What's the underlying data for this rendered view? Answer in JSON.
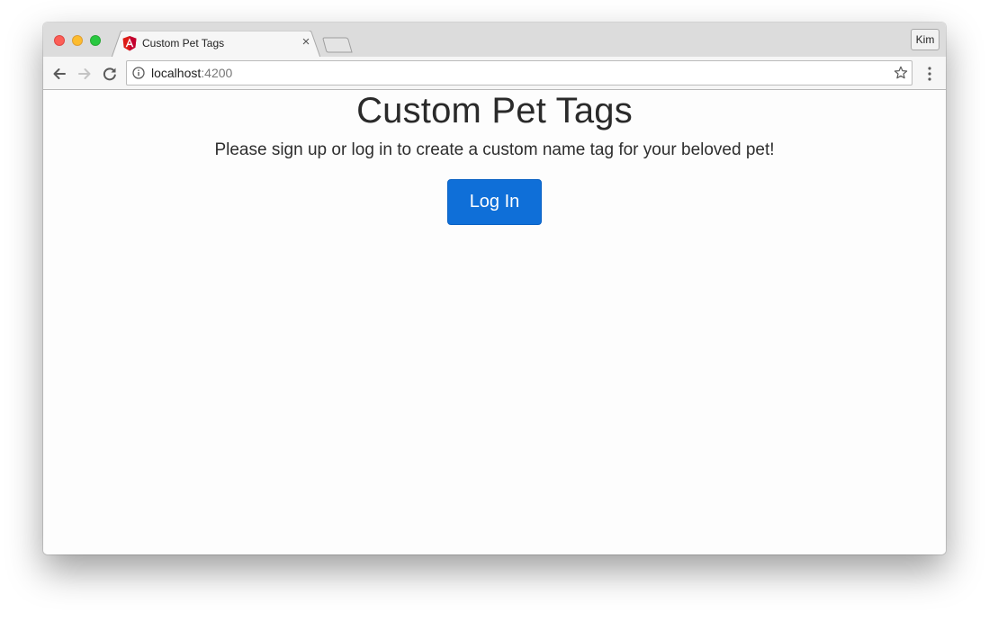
{
  "browser": {
    "tab": {
      "title": "Custom Pet Tags",
      "favicon": "angular-icon",
      "close_glyph": "×"
    },
    "profile_label": "Kim",
    "address": {
      "host": "localhost",
      "port": ":4200"
    },
    "icons": {
      "back": "back-arrow-icon",
      "forward": "forward-arrow-icon",
      "reload": "reload-icon",
      "info": "info-icon",
      "bookmark": "star-icon",
      "menu": "vertical-dots-icon"
    }
  },
  "page": {
    "title": "Custom Pet Tags",
    "subtitle": "Please sign up or log in to create a custom name tag for your beloved pet!",
    "login_label": "Log In"
  },
  "colors": {
    "accent": "#0f6fd8",
    "favicon_red": "#dd1b16",
    "traffic_red": "#fc5f57",
    "traffic_yellow": "#fdbc2e",
    "traffic_green": "#28c840"
  }
}
